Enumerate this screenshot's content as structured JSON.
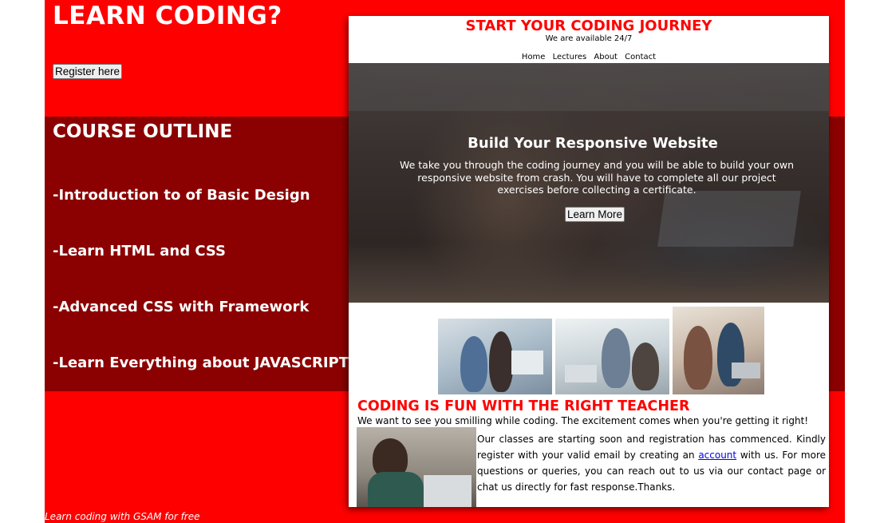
{
  "header": {
    "title": "LEARN CODING?",
    "register_label": "Register here"
  },
  "outline": {
    "title": "COURSE OUTLINE",
    "items": [
      "-Introduction to of Basic Design",
      "-Learn HTML and CSS",
      "-Advanced CSS with Framework",
      "-Learn Everything about JAVASCRIPT"
    ]
  },
  "card": {
    "title": "START YOUR CODING JOURNEY",
    "subtitle": "We are available 24/7",
    "nav": [
      "Home",
      "Lectures",
      "About",
      "Contact"
    ],
    "hero": {
      "title": "Build Your Responsive Website",
      "text": "We take you through the coding journey and you will be able to build your own responsive website from crash. You will have to complete all our project exercises before collecting a certificate.",
      "button": "Learn More"
    },
    "fun_title": "CODING IS FUN WITH THE RIGHT TEACHER",
    "fun_subtitle": "We want to see you smilling while coding. The excitement comes when you're getting it right!",
    "body_before_link": "Our classes are starting soon and registration has commenced. Kindly register with your valid email by creating an ",
    "body_link": "account",
    "body_after_link": " with us. For more questions or queries, you can reach out to us via our contact page or chat us directly for fast response.Thanks."
  },
  "footer": {
    "text": "Learn coding with GSAM for free"
  },
  "colors": {
    "accent": "#ff0000",
    "dark_band": "#8b0000"
  }
}
